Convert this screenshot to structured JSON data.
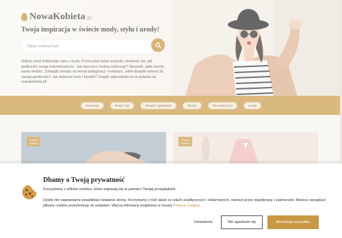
{
  "logo": {
    "name": "NowaKobieta",
    "tld": ".pl"
  },
  "hero": {
    "tagline": "Twoja inspiracja w świecie mody, stylu i urody!",
    "search": {
      "placeholder": "Wpisz szukaną frazę"
    },
    "intro": "Odkryj świat kobiecego stylu i urody. Przeczytaj nasze artykuły i dowiedz się, jak podkreślić swoją indywidualność. Jak stworzyć modną stylizację? Sprawdź, jakie trendy warto śledzić. Zdobądź wiedzę na temat pielęgnacji i makijażu. Jakie dodatki wnieść do swojej garderoby? Jak dobierać buty i torebki? Znajdź odpowiedzi na te pytania na nowakobieta.pl!"
  },
  "categories": [
    "Akcesoria",
    "Moda i styl",
    "Obuwie i galanteria",
    "Okazje",
    "Personalizacja",
    "Uroda"
  ],
  "cards": [
    {
      "badge": "Portal Polecа"
    },
    {
      "badge": "Portal Poleca"
    }
  ],
  "cookie": {
    "title": "Dbamy o Twoją prywatność",
    "text1": "Korzystamy z plików cookies, które zapisują się w pamięci Twojej przeglądarki.",
    "text2_a": "Dzięki nim zapewniamy prawidłowe działanie strony. Korzystamy z nich także w celach analitycznych i reklamowych, również przez współpracę z partnerami. Możesz zarządzać plikami cookies przechodząc do ustawień. Więcej informacji znajdziesz w naszej ",
    "link": "Polityce Cookies",
    "text2_b": ".",
    "buttons": {
      "settings": "Ustawienia",
      "reject": "Nie zgadzam się",
      "accept": "Akceptuję wszystkie"
    }
  },
  "colors": {
    "accent": "#c99843",
    "chip_bg": "#f5e9d4"
  }
}
